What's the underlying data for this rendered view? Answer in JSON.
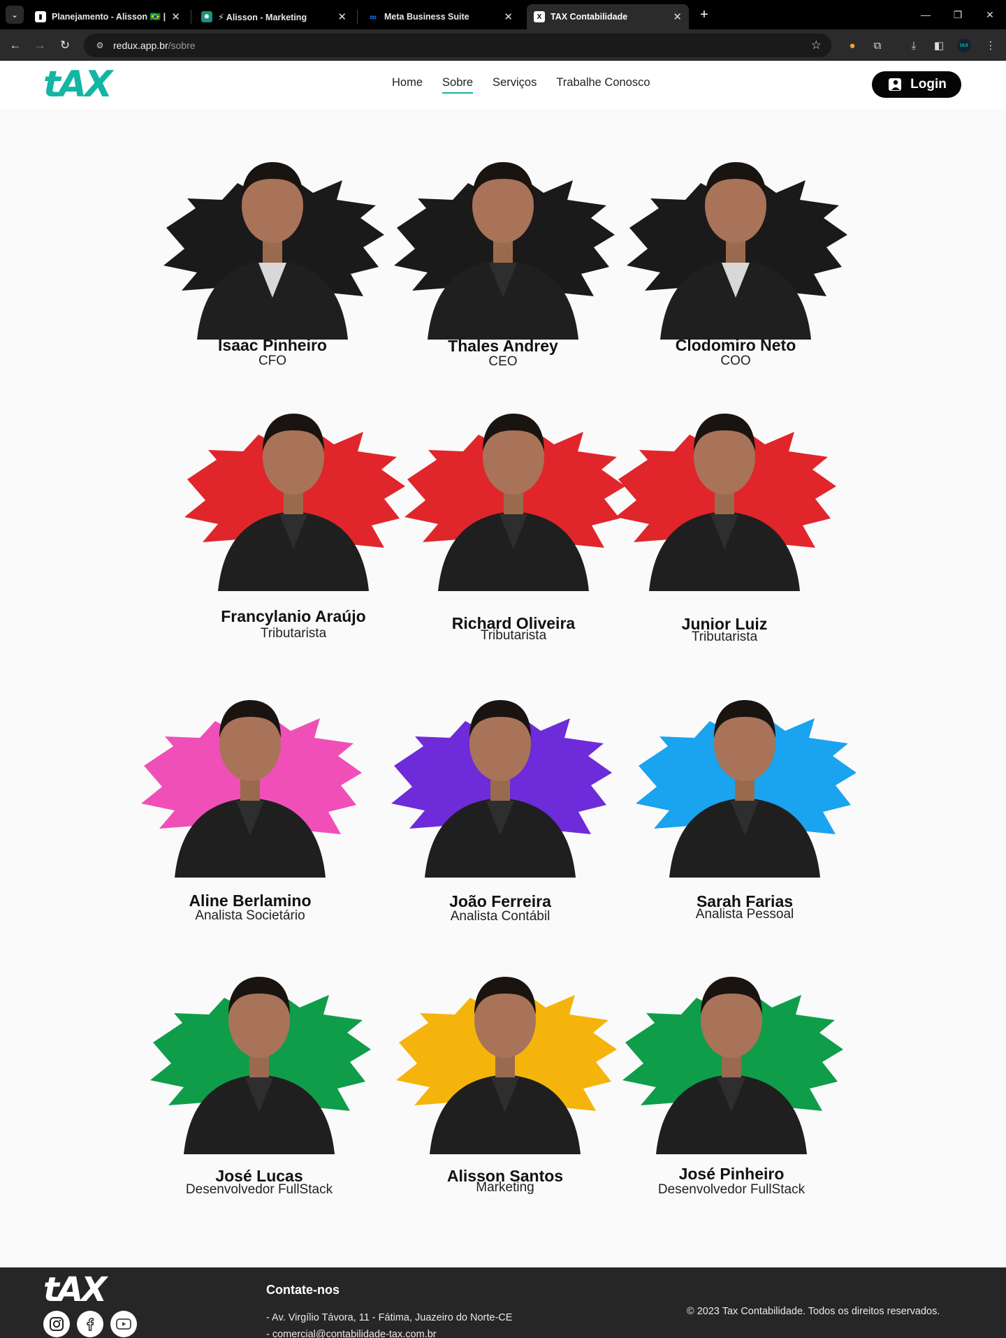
{
  "browser": {
    "tabs": [
      {
        "title": "Planejamento - Alisson 🇧🇷 | Tr",
        "active": false
      },
      {
        "title": "⚡ Alisson - Marketing",
        "active": false
      },
      {
        "title": "Meta Business Suite",
        "active": false
      },
      {
        "title": "TAX Contabilidade",
        "active": true
      }
    ],
    "url_host": "redux.app.br",
    "url_path": "/sobre"
  },
  "site": {
    "logo_text": "tAX",
    "nav": [
      "Home",
      "Sobre",
      "Serviços",
      "Trabalhe Conosco"
    ],
    "active_nav": "Sobre",
    "login_label": "Login",
    "accent_color": "#13b5a3"
  },
  "team": [
    {
      "name": "Isaac Pinheiro",
      "role": "CFO",
      "splash_color": "#1a1a1a"
    },
    {
      "name": "Thales Andrey",
      "role": "CEO",
      "splash_color": "#1a1a1a"
    },
    {
      "name": "Clodomiro Neto",
      "role": "COO",
      "splash_color": "#1a1a1a"
    },
    {
      "name": "Francylanio Araújo",
      "role": "Tributarista",
      "splash_color": "#e0262b"
    },
    {
      "name": "Richard Oliveira",
      "role": "Tributarista",
      "splash_color": "#e0262b"
    },
    {
      "name": "Junior Luiz",
      "role": "Tributarista",
      "splash_color": "#e0262b"
    },
    {
      "name": "Aline Berlamino",
      "role": "Analista Societário",
      "splash_color": "#f04fb8"
    },
    {
      "name": "João Ferreira",
      "role": "Analista Contábil",
      "splash_color": "#6e2bd9"
    },
    {
      "name": "Sarah Farias",
      "role": "Analista Pessoal",
      "splash_color": "#1aa3ee"
    },
    {
      "name": "José Lucas",
      "role": "Desenvolvedor FullStack",
      "splash_color": "#0f9d4a"
    },
    {
      "name": "Alisson Santos",
      "role": "Marketing",
      "splash_color": "#f5b40c"
    },
    {
      "name": "José Pinheiro",
      "role": "Desenvolvedor FullStack",
      "splash_color": "#0f9d4a"
    }
  ],
  "footer": {
    "logo_text": "tAX",
    "contact_title": "Contate-nos",
    "address": "- Av. Virgílio Távora, 11 - Fátima, Juazeiro do Norte-CE",
    "email": "- comercial@contabilidade-tax.com.br",
    "copyright": "© 2023 Tax Contabilidade. Todos os direitos reservados.",
    "social": [
      "instagram-icon",
      "facebook-icon",
      "youtube-icon"
    ]
  }
}
